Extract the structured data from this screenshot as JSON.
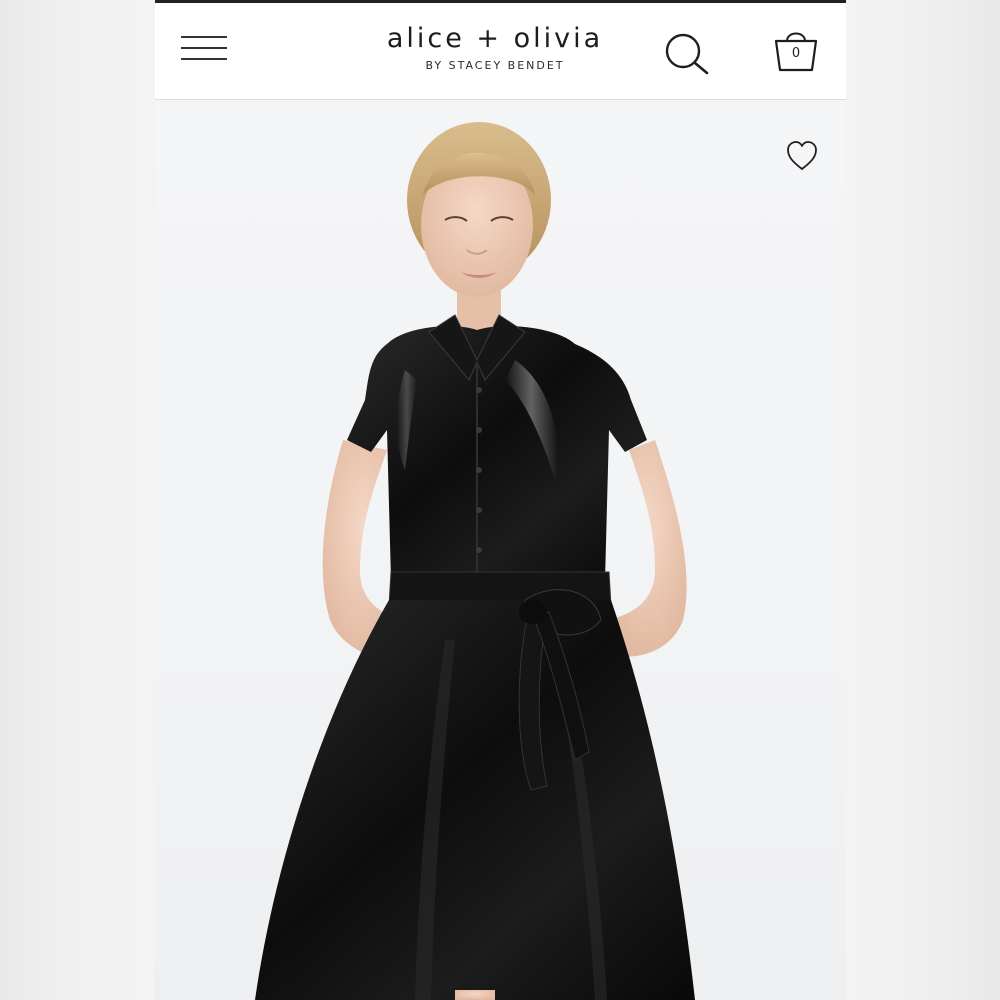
{
  "header": {
    "brand_name": "alice + olivia",
    "brand_tagline": "BY STACEY BENDET",
    "cart_count": "0"
  },
  "icons": {
    "menu": "hamburger-icon",
    "search": "search-icon",
    "cart": "shopping-bag-icon",
    "wishlist": "heart-icon"
  },
  "colors": {
    "header_background": "#ffffff",
    "text": "#1c1c1c",
    "photo_background": "#f3f4f6",
    "dress": "#111111"
  }
}
